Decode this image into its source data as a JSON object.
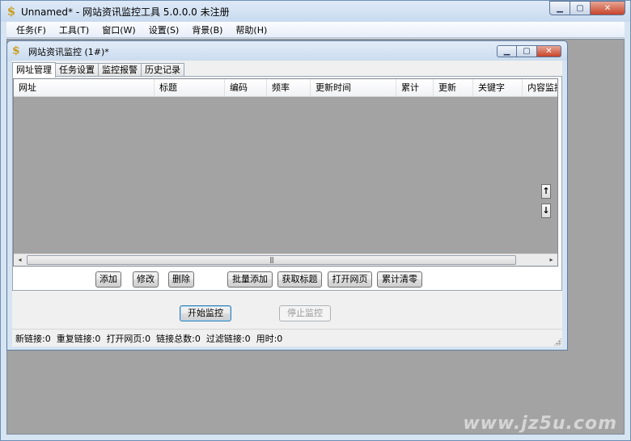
{
  "app": {
    "title": "Unnamed* - 网站资讯监控工具 5.0.0.0  未注册",
    "icon": "dollar-sign-icon"
  },
  "menu": [
    {
      "label": "任务(F)"
    },
    {
      "label": "工具(T)"
    },
    {
      "label": "窗口(W)"
    },
    {
      "label": "设置(S)"
    },
    {
      "label": "背景(B)"
    },
    {
      "label": "帮助(H)"
    }
  ],
  "child": {
    "title": "网站资讯监控  (1#)*",
    "tabs": [
      {
        "label": "网址管理"
      },
      {
        "label": "任务设置"
      },
      {
        "label": "监控报警"
      },
      {
        "label": "历史记录"
      }
    ],
    "columns": [
      {
        "label": "网址"
      },
      {
        "label": "标题"
      },
      {
        "label": "编码"
      },
      {
        "label": "频率"
      },
      {
        "label": "更新时间"
      },
      {
        "label": "累计"
      },
      {
        "label": "更新"
      },
      {
        "label": "关键字"
      },
      {
        "label": "内容监控"
      }
    ],
    "move_up": "↑",
    "move_down": "↓",
    "scroll_left": "◂",
    "scroll_right": "▸",
    "scroll_grip": "|||",
    "buttons": {
      "add": "添加",
      "edit": "修改",
      "delete": "删除",
      "batch_add": "批量添加",
      "get_title": "获取标题",
      "open_page": "打开网页",
      "clear_total": "累计清零",
      "start": "开始监控",
      "stop": "停止监控"
    },
    "status": [
      "新链接:0",
      "重复链接:0",
      "打开网页:0",
      "链接总数:0",
      "过滤链接:0",
      "用时:0"
    ]
  },
  "watermark": "www.jz5u.com"
}
